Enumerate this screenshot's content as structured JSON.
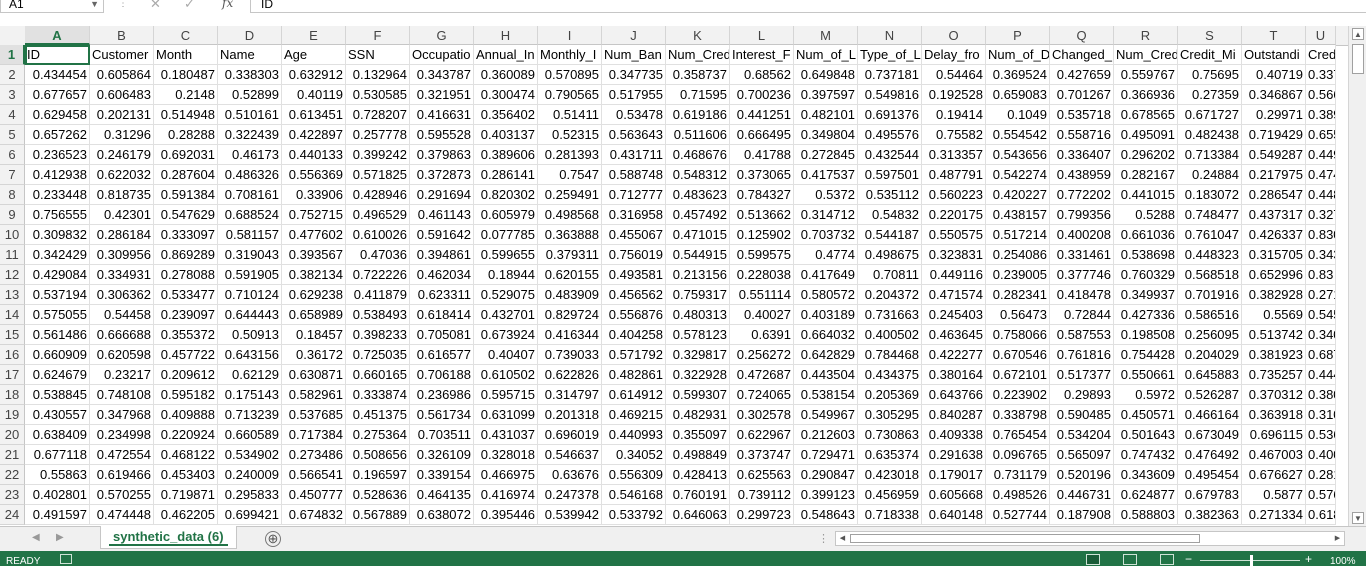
{
  "formula_bar": {
    "name_box": "A1",
    "cancel_icon": "✕",
    "enter_icon": "✓",
    "fx_label": "fx",
    "content": "ID"
  },
  "columns": [
    "A",
    "B",
    "C",
    "D",
    "E",
    "F",
    "G",
    "H",
    "I",
    "J",
    "K",
    "L",
    "M",
    "N",
    "O",
    "P",
    "Q",
    "R",
    "S",
    "T",
    "U"
  ],
  "rows": [
    "1",
    "2",
    "3",
    "4",
    "5",
    "6",
    "7",
    "8",
    "9",
    "10",
    "11",
    "12",
    "13",
    "14",
    "15",
    "16",
    "17",
    "18",
    "19",
    "20",
    "21",
    "22",
    "23",
    "24"
  ],
  "active_cell": "A1",
  "cells": [
    [
      "ID",
      "Customer",
      "Month",
      "Name",
      "Age",
      "SSN",
      "Occupatio",
      "Annual_In",
      "Monthly_I",
      "Num_Ban",
      "Num_Cred",
      "Interest_F",
      "Num_of_L",
      "Type_of_L",
      "Delay_fro",
      "Num_of_D",
      "Changed_",
      "Num_Cred",
      "Credit_Mi",
      "Outstandi",
      "Credit"
    ],
    [
      "0.434454",
      "0.605864",
      "0.180487",
      "0.338303",
      "0.632912",
      "0.132964",
      "0.343787",
      "0.360089",
      "0.570895",
      "0.347735",
      "0.358737",
      "0.68562",
      "0.649848",
      "0.737181",
      "0.54464",
      "0.369524",
      "0.427659",
      "0.559767",
      "0.75695",
      "0.40719",
      "0.337"
    ],
    [
      "0.677657",
      "0.606483",
      "0.2148",
      "0.52899",
      "0.40119",
      "0.530585",
      "0.321951",
      "0.300474",
      "0.790565",
      "0.517955",
      "0.71595",
      "0.700236",
      "0.397597",
      "0.549816",
      "0.192528",
      "0.659083",
      "0.701267",
      "0.366936",
      "0.27359",
      "0.346867",
      "0.566"
    ],
    [
      "0.629458",
      "0.202131",
      "0.514948",
      "0.510161",
      "0.613451",
      "0.728207",
      "0.416631",
      "0.356402",
      "0.51411",
      "0.53478",
      "0.619186",
      "0.441251",
      "0.482101",
      "0.691376",
      "0.19414",
      "0.1049",
      "0.535718",
      "0.678565",
      "0.671727",
      "0.29971",
      "0.389"
    ],
    [
      "0.657262",
      "0.31296",
      "0.28288",
      "0.322439",
      "0.422897",
      "0.257778",
      "0.595528",
      "0.403137",
      "0.52315",
      "0.563643",
      "0.511606",
      "0.666495",
      "0.349804",
      "0.495576",
      "0.75582",
      "0.554542",
      "0.558716",
      "0.495091",
      "0.482438",
      "0.719429",
      "0.655"
    ],
    [
      "0.236523",
      "0.246179",
      "0.692031",
      "0.46173",
      "0.440133",
      "0.399242",
      "0.379863",
      "0.389606",
      "0.281393",
      "0.431711",
      "0.468676",
      "0.41788",
      "0.272845",
      "0.432544",
      "0.313357",
      "0.543656",
      "0.336407",
      "0.296202",
      "0.713384",
      "0.549287",
      "0.449"
    ],
    [
      "0.412938",
      "0.622032",
      "0.287604",
      "0.486326",
      "0.556369",
      "0.571825",
      "0.372873",
      "0.286141",
      "0.7547",
      "0.588748",
      "0.548312",
      "0.373065",
      "0.417537",
      "0.597501",
      "0.487791",
      "0.542274",
      "0.438959",
      "0.282167",
      "0.24884",
      "0.217975",
      "0.474"
    ],
    [
      "0.233448",
      "0.818735",
      "0.591384",
      "0.708161",
      "0.33906",
      "0.428946",
      "0.291694",
      "0.820302",
      "0.259491",
      "0.712777",
      "0.483623",
      "0.784327",
      "0.5372",
      "0.535112",
      "0.560223",
      "0.420227",
      "0.772202",
      "0.441015",
      "0.183072",
      "0.286547",
      "0.448"
    ],
    [
      "0.756555",
      "0.42301",
      "0.547629",
      "0.688524",
      "0.752715",
      "0.496529",
      "0.461143",
      "0.605979",
      "0.498568",
      "0.316958",
      "0.457492",
      "0.513662",
      "0.314712",
      "0.54832",
      "0.220175",
      "0.438157",
      "0.799356",
      "0.5288",
      "0.748477",
      "0.437317",
      "0.327"
    ],
    [
      "0.309832",
      "0.286184",
      "0.333097",
      "0.581157",
      "0.477602",
      "0.610026",
      "0.591642",
      "0.077785",
      "0.363888",
      "0.455067",
      "0.471015",
      "0.125902",
      "0.703732",
      "0.544187",
      "0.550575",
      "0.517214",
      "0.400208",
      "0.661036",
      "0.761047",
      "0.426337",
      "0.830"
    ],
    [
      "0.342429",
      "0.309956",
      "0.869289",
      "0.319043",
      "0.393567",
      "0.47036",
      "0.394861",
      "0.599655",
      "0.379311",
      "0.756019",
      "0.544915",
      "0.599575",
      "0.4774",
      "0.498675",
      "0.323831",
      "0.254086",
      "0.331461",
      "0.538698",
      "0.448323",
      "0.315705",
      "0.343"
    ],
    [
      "0.429084",
      "0.334931",
      "0.278088",
      "0.591905",
      "0.382134",
      "0.722226",
      "0.462034",
      "0.18944",
      "0.620155",
      "0.493581",
      "0.213156",
      "0.228038",
      "0.417649",
      "0.70811",
      "0.449116",
      "0.239005",
      "0.377746",
      "0.760329",
      "0.568518",
      "0.652996",
      "0.83"
    ],
    [
      "0.537194",
      "0.306362",
      "0.533477",
      "0.710124",
      "0.629238",
      "0.411879",
      "0.623311",
      "0.529075",
      "0.483909",
      "0.456562",
      "0.759317",
      "0.551114",
      "0.580572",
      "0.204372",
      "0.471574",
      "0.282341",
      "0.418478",
      "0.349937",
      "0.701916",
      "0.382928",
      "0.271"
    ],
    [
      "0.575055",
      "0.54458",
      "0.239097",
      "0.644443",
      "0.658989",
      "0.538493",
      "0.618414",
      "0.432701",
      "0.829724",
      "0.556876",
      "0.480313",
      "0.40027",
      "0.403189",
      "0.731663",
      "0.245403",
      "0.56473",
      "0.72844",
      "0.427336",
      "0.586516",
      "0.5569",
      "0.545"
    ],
    [
      "0.561486",
      "0.666688",
      "0.355372",
      "0.50913",
      "0.18457",
      "0.398233",
      "0.705081",
      "0.673924",
      "0.416344",
      "0.404258",
      "0.578123",
      "0.6391",
      "0.664032",
      "0.400502",
      "0.463645",
      "0.758066",
      "0.587553",
      "0.198508",
      "0.256095",
      "0.513742",
      "0.340"
    ],
    [
      "0.660909",
      "0.620598",
      "0.457722",
      "0.643156",
      "0.36172",
      "0.725035",
      "0.616577",
      "0.40407",
      "0.739033",
      "0.571792",
      "0.329817",
      "0.256272",
      "0.642829",
      "0.784468",
      "0.422277",
      "0.670546",
      "0.761816",
      "0.754428",
      "0.204029",
      "0.381923",
      "0.687"
    ],
    [
      "0.624679",
      "0.23217",
      "0.209612",
      "0.62129",
      "0.630871",
      "0.660165",
      "0.706188",
      "0.610502",
      "0.622826",
      "0.482861",
      "0.322928",
      "0.472687",
      "0.443504",
      "0.434375",
      "0.380164",
      "0.672101",
      "0.517377",
      "0.550661",
      "0.645883",
      "0.735257",
      "0.444"
    ],
    [
      "0.538845",
      "0.748108",
      "0.595182",
      "0.175143",
      "0.582961",
      "0.333874",
      "0.236986",
      "0.595715",
      "0.314797",
      "0.614912",
      "0.599307",
      "0.724065",
      "0.538154",
      "0.205369",
      "0.643766",
      "0.223902",
      "0.29893",
      "0.5972",
      "0.526287",
      "0.370312",
      "0.380"
    ],
    [
      "0.430557",
      "0.347968",
      "0.409888",
      "0.713239",
      "0.537685",
      "0.451375",
      "0.561734",
      "0.631099",
      "0.201318",
      "0.469215",
      "0.482931",
      "0.302578",
      "0.549967",
      "0.305295",
      "0.840287",
      "0.338798",
      "0.590485",
      "0.450571",
      "0.466164",
      "0.363918",
      "0.310"
    ],
    [
      "0.638409",
      "0.234998",
      "0.220924",
      "0.660589",
      "0.717384",
      "0.275364",
      "0.703511",
      "0.431037",
      "0.696019",
      "0.440993",
      "0.355097",
      "0.622967",
      "0.212603",
      "0.730863",
      "0.409338",
      "0.765454",
      "0.534204",
      "0.501643",
      "0.673049",
      "0.696115",
      "0.536"
    ],
    [
      "0.677118",
      "0.472554",
      "0.468122",
      "0.534902",
      "0.273486",
      "0.508656",
      "0.326109",
      "0.328018",
      "0.546637",
      "0.34052",
      "0.498849",
      "0.373747",
      "0.729471",
      "0.635374",
      "0.291638",
      "0.096765",
      "0.565097",
      "0.747432",
      "0.476492",
      "0.467003",
      "0.400"
    ],
    [
      "0.55863",
      "0.619466",
      "0.453403",
      "0.240009",
      "0.566541",
      "0.196597",
      "0.339154",
      "0.466975",
      "0.63676",
      "0.556309",
      "0.428413",
      "0.625563",
      "0.290847",
      "0.423018",
      "0.179017",
      "0.731179",
      "0.520196",
      "0.343609",
      "0.495454",
      "0.676627",
      "0.281"
    ],
    [
      "0.402801",
      "0.570255",
      "0.719871",
      "0.295833",
      "0.450777",
      "0.528636",
      "0.464135",
      "0.416974",
      "0.247378",
      "0.546168",
      "0.760191",
      "0.739112",
      "0.399123",
      "0.456959",
      "0.605668",
      "0.498526",
      "0.446731",
      "0.624877",
      "0.679783",
      "0.5877",
      "0.576"
    ],
    [
      "0.491597",
      "0.474448",
      "0.462205",
      "0.699421",
      "0.674832",
      "0.567889",
      "0.638072",
      "0.395446",
      "0.539942",
      "0.533792",
      "0.646063",
      "0.299723",
      "0.548643",
      "0.718338",
      "0.640148",
      "0.527744",
      "0.187908",
      "0.588803",
      "0.382363",
      "0.271334",
      "0.618"
    ]
  ],
  "sheet_tabs": {
    "active": "synthetic_data (6)",
    "add_sheet_icon": "⊕"
  },
  "status_bar": {
    "status": "READY",
    "zoom": "100%"
  },
  "theme": {
    "accent": "#217346",
    "header_bg": "#f2f2f2",
    "grid": "#e0e0e0"
  }
}
